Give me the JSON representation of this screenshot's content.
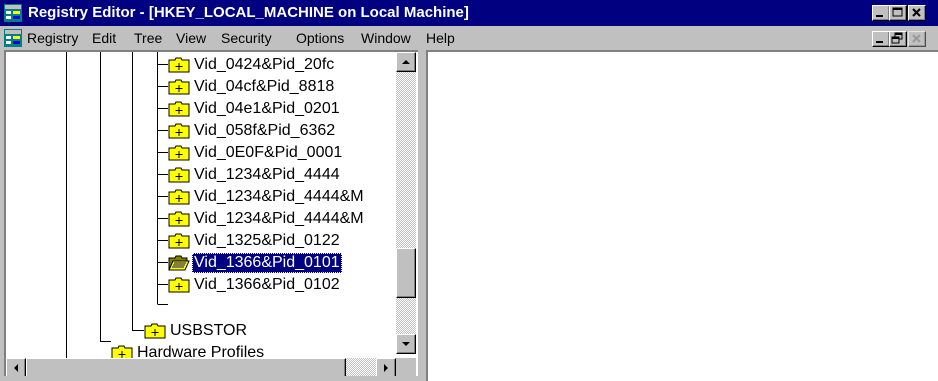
{
  "window": {
    "title": "Registry Editor - [HKEY_LOCAL_MACHINE on Local Machine]"
  },
  "menu": {
    "items": [
      "Registry",
      "Edit",
      "Tree",
      "View",
      "Security",
      "Options",
      "Window",
      "Help"
    ]
  },
  "tree": {
    "nodes": [
      {
        "label": "Vid_0424&Pid_20fc",
        "selected": false
      },
      {
        "label": "Vid_04cf&Pid_8818",
        "selected": false
      },
      {
        "label": "Vid_04e1&Pid_0201",
        "selected": false
      },
      {
        "label": "Vid_058f&Pid_6362",
        "selected": false
      },
      {
        "label": "Vid_0E0F&Pid_0001",
        "selected": false
      },
      {
        "label": "Vid_1234&Pid_4444",
        "selected": false
      },
      {
        "label": "Vid_1234&Pid_4444&M",
        "selected": false
      },
      {
        "label": "Vid_1234&Pid_4444&M",
        "selected": false
      },
      {
        "label": "Vid_1325&Pid_0122",
        "selected": false
      },
      {
        "label": "Vid_1366&Pid_0101",
        "selected": true
      },
      {
        "label": "Vid_1366&Pid_0102",
        "selected": false
      },
      {
        "label": "USBSTOR",
        "selected": false
      },
      {
        "label": "Hardware Profiles",
        "selected": false
      }
    ]
  },
  "icons": {
    "app": "registry-icon",
    "folder": "folder-plus-icon",
    "selected_folder": "open-folder-icon"
  },
  "colors": {
    "title_bar": "#000080",
    "selection": "#000080",
    "face": "#c0c0c0",
    "folder": "#ffff00"
  }
}
